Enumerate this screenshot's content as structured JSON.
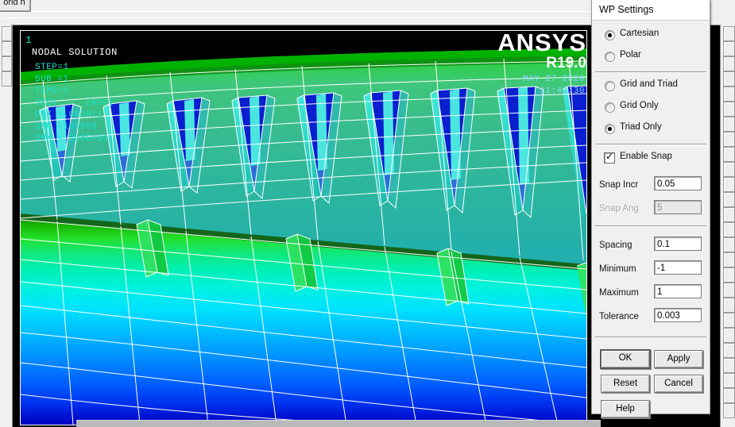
{
  "host": {
    "toolbar_button_label": "orld h"
  },
  "graphics": {
    "plot_number": "1",
    "title": "NODAL SOLUTION",
    "info_lines": [
      "STEP=1",
      "SUB =1",
      "TIME=1",
      "SEQV     (AVG)",
      "DMX =.002911",
      "SMN =105069",
      "SMX =.208E+09"
    ],
    "brand": "ANSYS",
    "release": "R19.0",
    "date": "MAY 27 2020",
    "time": "11:47:30",
    "background_color": "#000000",
    "mesh_line_color": "#ffffff",
    "contour_colors": [
      "#0000c8",
      "#0040ff",
      "#0080ff",
      "#00b4ff",
      "#00e0ff",
      "#00ffd0",
      "#00e09a",
      "#16b98a",
      "#34a37e",
      "#3ec77a",
      "#38d43a",
      "#00c000"
    ]
  },
  "dialog": {
    "title": "WP Settings",
    "coordinate_system": {
      "options": [
        {
          "label": "Cartesian",
          "selected": true
        },
        {
          "label": "Polar",
          "selected": false
        }
      ]
    },
    "display_mode": {
      "options": [
        {
          "label": "Grid and Triad",
          "selected": false
        },
        {
          "label": "Grid Only",
          "selected": false
        },
        {
          "label": "Triad Only",
          "selected": true
        }
      ]
    },
    "enable_snap": {
      "label": "Enable Snap",
      "checked": true
    },
    "snap_fields": [
      {
        "label": "Snap Incr",
        "value": "0.05",
        "disabled": false
      },
      {
        "label": "Snap Ang",
        "value": "5",
        "disabled": true
      }
    ],
    "grid_fields": [
      {
        "label": "Spacing",
        "value": "0.1",
        "disabled": false
      },
      {
        "label": "Minimum",
        "value": "-1",
        "disabled": false
      },
      {
        "label": "Maximum",
        "value": "1",
        "disabled": false
      },
      {
        "label": "Tolerance",
        "value": "0.003",
        "disabled": false
      }
    ],
    "buttons": {
      "ok": "OK",
      "apply": "Apply",
      "reset": "Reset",
      "cancel": "Cancel",
      "help": "Help"
    }
  }
}
